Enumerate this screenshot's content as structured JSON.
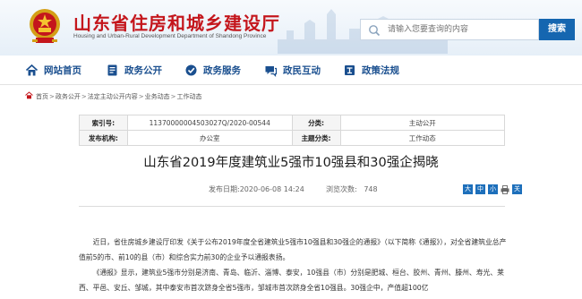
{
  "header": {
    "site_title": "山东省住房和城乡建设厅",
    "site_subtitle": "Housing and Urban-Rural Development Department of Shandong Province",
    "search_placeholder": "请输入您要查询的内容",
    "search_button": "搜索",
    "brand_color": "#c4161c",
    "accent_color": "#1566b0"
  },
  "nav": {
    "items": [
      {
        "label": "网站首页",
        "icon": "home-icon"
      },
      {
        "label": "政务公开",
        "icon": "document-icon"
      },
      {
        "label": "政务服务",
        "icon": "service-icon"
      },
      {
        "label": "政民互动",
        "icon": "interaction-icon"
      },
      {
        "label": "政策法规",
        "icon": "law-icon"
      }
    ]
  },
  "breadcrumb": [
    "首页",
    "政务公开",
    "法定主动公开内容",
    "业务动态",
    "工作动态"
  ],
  "meta": {
    "index_label": "索引号:",
    "index_value": "11370000004503027Q/2020-00544",
    "category_label": "分类:",
    "category_value": "主动公开",
    "issuer_label": "发布机构:",
    "issuer_value": "办公室",
    "topic_label": "主题分类:",
    "topic_value": "工作动态"
  },
  "article": {
    "title": "山东省2019年度建筑业5强市10强县和30强企揭晓",
    "publish_date": "发布日期:2020-06-08 14:24",
    "views_label": "浏览次数:",
    "views_value": "748",
    "font_large": "大",
    "font_medium": "中",
    "font_small": "小",
    "close": "关",
    "paragraph1": "近日，省住房城乡建设厅印发《关于公布2019年度全省建筑业5强市10强县和30强企的通报》（以下简称《通报》），对全省建筑业总产值前5的市、前10的县（市）和综合实力前30的企业予以通报表扬。",
    "paragraph2": "《通报》显示，建筑业5强市分别是济南、青岛、临沂、淄博、泰安，10强县（市）分别是肥城、桓台、胶州、青州、滕州、寿光、莱西、平邑、安丘、邹城，其中泰安市首次跻身全省5强市，邹城市首次跻身全省10强县。30强企中，产值超100亿"
  }
}
